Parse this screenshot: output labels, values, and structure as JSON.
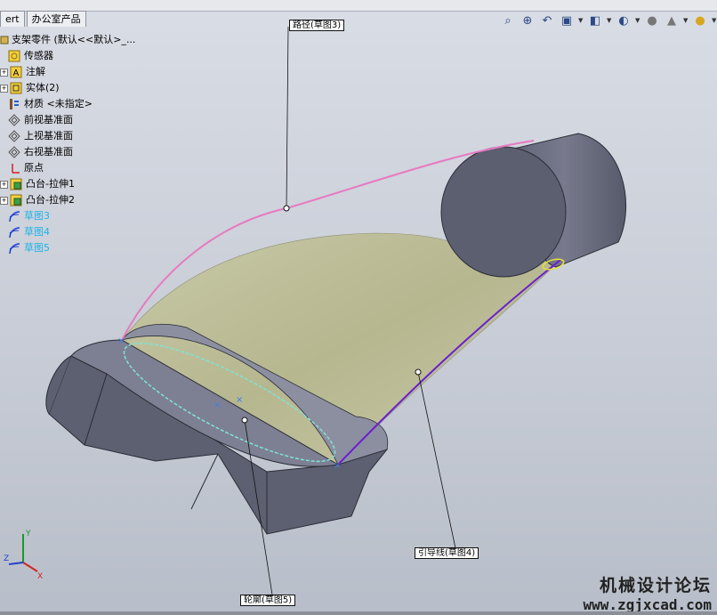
{
  "tabs": [
    "ert",
    "办公室产品"
  ],
  "feature_tree": {
    "root": "支架零件 (默认<<默认>_...",
    "items": [
      {
        "label": "传感器",
        "icon": "sensor-icon",
        "expandable": false,
        "color": "default"
      },
      {
        "label": "注解",
        "icon": "annotation-icon",
        "expandable": true,
        "color": "default"
      },
      {
        "label": "实体(2)",
        "icon": "solid-bodies-icon",
        "expandable": true,
        "color": "default"
      },
      {
        "label": "材质 <未指定>",
        "icon": "material-icon",
        "expandable": false,
        "color": "default"
      },
      {
        "label": "前视基准面",
        "icon": "plane-icon",
        "expandable": false,
        "color": "default"
      },
      {
        "label": "上视基准面",
        "icon": "plane-icon",
        "expandable": false,
        "color": "default"
      },
      {
        "label": "右视基准面",
        "icon": "plane-icon",
        "expandable": false,
        "color": "default"
      },
      {
        "label": "原点",
        "icon": "origin-icon",
        "expandable": false,
        "color": "default"
      },
      {
        "label": "凸台-拉伸1",
        "icon": "boss-extrude-icon",
        "expandable": true,
        "color": "default"
      },
      {
        "label": "凸台-拉伸2",
        "icon": "boss-extrude-icon",
        "expandable": true,
        "color": "default"
      },
      {
        "label": "草图3",
        "icon": "sketch-icon",
        "expandable": false,
        "color": "cyan"
      },
      {
        "label": "草图4",
        "icon": "sketch-icon",
        "expandable": false,
        "color": "cyan"
      },
      {
        "label": "草图5",
        "icon": "sketch-icon",
        "expandable": false,
        "color": "cyan"
      }
    ]
  },
  "heads_up_toolbar": [
    "zoom-to-fit-icon",
    "zoom-area-icon",
    "previous-view-icon",
    "section-view-icon",
    "view-orientation-icon",
    "display-style-icon",
    "hide-show-icon",
    "edit-appearance-icon",
    "apply-scene-icon"
  ],
  "callouts": {
    "path": "路径(草图3)",
    "guide": "引导线(草图4)",
    "profile": "轮廓(草图5)"
  },
  "triad": {
    "x": "X",
    "y": "Y",
    "z": "Z"
  },
  "watermark": {
    "title": "机械设计论坛",
    "url": "www.zgjxcad.com"
  },
  "colors": {
    "path_curve": "#e879c0",
    "guide_curve": "#6a1fd0",
    "profile_curve": "#7fe3d6",
    "sweep_surface": "#c6c7a4",
    "body": "#6a6d7e",
    "sketch_label": "#22b2e6"
  }
}
